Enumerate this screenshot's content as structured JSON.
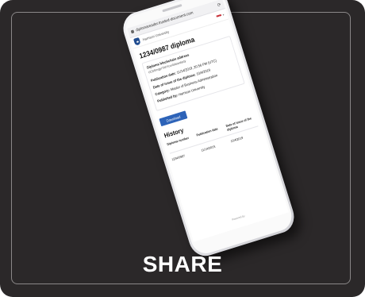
{
  "browser": {
    "url": "diplomareader.trusted-document.com"
  },
  "app": {
    "university": "Harrison University"
  },
  "diploma": {
    "title": "1234/0987 diploma",
    "blockchain_label": "Diploma blockchain address",
    "blockchain_value": "UCbSmqprTkhYcuxbdewdaxty",
    "publication_label": "Publication date:",
    "publication_value": "11/14/2019, 20:56 PM (UTC)",
    "issue_label": "Date of issue of the diploma:",
    "issue_value": "10/4/2019",
    "category_label": "Category:",
    "category_value": "Master of Business Administration",
    "published_label": "Published by:",
    "published_value": "Harrison University",
    "download_label": "Download"
  },
  "history": {
    "title": "History",
    "columns": [
      "Diploma number",
      "Publication date",
      "Date of issue of the diploma"
    ],
    "rows": [
      [
        "1234/0987",
        "11/14/2019,",
        "10/4/2019"
      ]
    ]
  },
  "footer": {
    "powered": "Powered by"
  },
  "share_label": "SHARE",
  "colors": {
    "background": "#2b2829",
    "accent": "#2d63b8",
    "shield": "#1f4b8f"
  }
}
